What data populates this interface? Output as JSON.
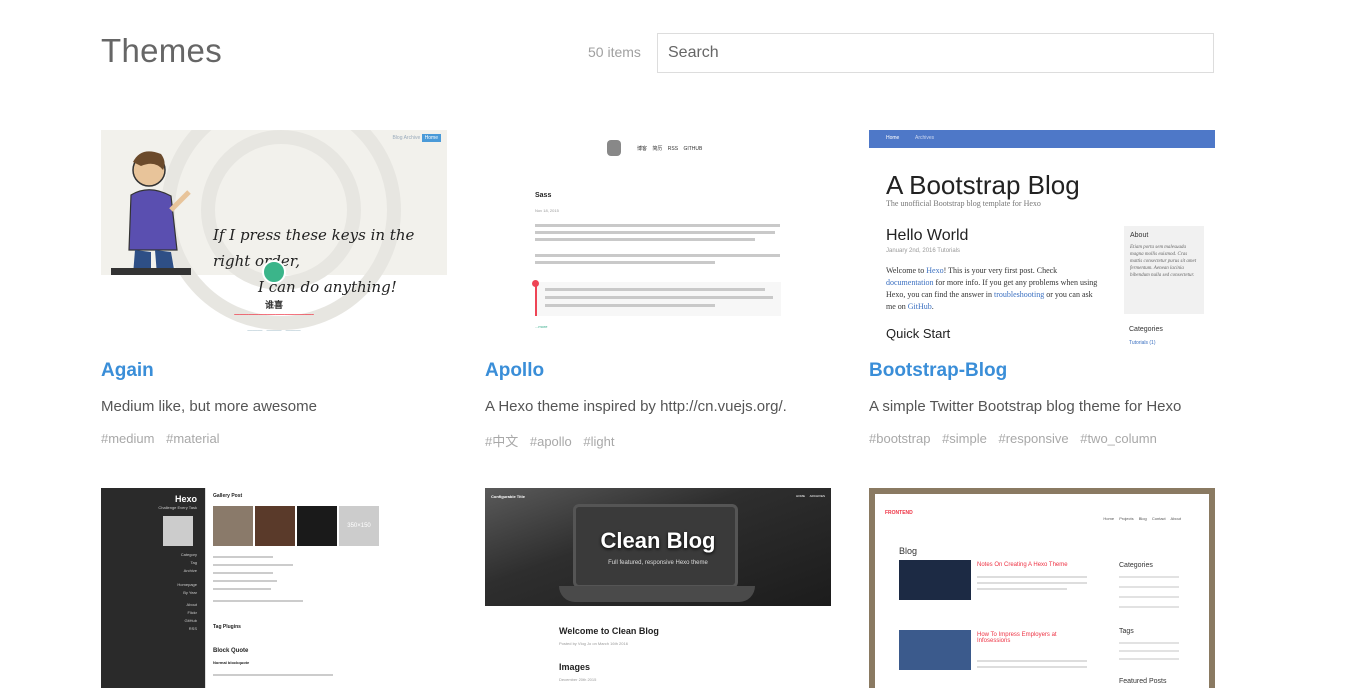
{
  "header": {
    "title": "Themes",
    "count": "50 items",
    "search_placeholder": "Search"
  },
  "themes": [
    {
      "name": "Again",
      "description": "Medium like, but more awesome",
      "tags": [
        "#medium",
        "#material"
      ],
      "preview": {
        "nav": "Blog Archive",
        "nav_active": "Home",
        "quote_line1": "If I press these keys in the right order,",
        "quote_line2": "I can do anything!",
        "author": "谁喜"
      }
    },
    {
      "name": "Apollo",
      "description": "A Hexo theme inspired by http://cn.vuejs.org/.",
      "tags": [
        "#中文",
        "#apollo",
        "#light"
      ],
      "preview": {
        "nav": "博客 简历 RSS GITHUB",
        "post_title": "Sass",
        "post_date": "Nov 18, 2015",
        "more": "...more"
      }
    },
    {
      "name": "Bootstrap-Blog",
      "description": "A simple Twitter Bootstrap blog theme for Hexo",
      "tags": [
        "#bootstrap",
        "#simple",
        "#responsive",
        "#two_column"
      ],
      "preview": {
        "nav_home": "Home",
        "nav_archives": "Archives",
        "blog_title": "A Bootstrap Blog",
        "blog_subtitle": "The unofficial Bootstrap blog template for Hexo",
        "post_title": "Hello World",
        "post_meta": "January 2nd, 2016   Tutorials",
        "post_body_1": "Welcome to ",
        "post_link_1": "Hexo",
        "post_body_2": "! This is your very first post. Check ",
        "post_link_2": "documentation",
        "post_body_3": " for more info. If you get any problems when using Hexo, you can find the answer in ",
        "post_link_3": "troubleshooting",
        "post_body_4": " or you can ask me on ",
        "post_link_4": "GitHub",
        "post_body_5": ".",
        "section": "Quick Start",
        "about_title": "About",
        "about_text": "Etiam porta sem malesuada magna mollis euismod. Cras mattis consectetur purus sit amet fermentum. Aenean lacinia bibendum nulla sed consectetur.",
        "categories_title": "Categories",
        "categories_item": "Tutorials (1)"
      }
    },
    {
      "name": "",
      "preview": {
        "site_title": "Hexo",
        "site_sub": "Challenge Every Task",
        "gallery_title": "Gallery Post",
        "tag_title": "Tag Plugins",
        "block_title": "Block Quote",
        "normal_title": "Normal blockquote",
        "menu": [
          "Category",
          "Tag",
          "Archive",
          "Homepage",
          "By Year",
          "About",
          "Flickr",
          "GitHub",
          "RSS"
        ],
        "placeholder": "350×150"
      }
    },
    {
      "name": "",
      "preview": {
        "configurable": "Configurable Title",
        "nav": "HOME ARCHIVES",
        "hero_title": "Clean Blog",
        "hero_sub": "Full featured, responsive Hexo theme",
        "post1_title": "Welcome to Clean Blog",
        "post1_meta": "Posted by Vlog Jo on March 16th 2016",
        "post2_title": "Images",
        "post2_meta": "December 20th 2015"
      }
    },
    {
      "name": "",
      "preview": {
        "brand": "FRONTEND",
        "nav": "Home Projects Blog Contact About",
        "heading": "Blog",
        "post1_title": "Notes On Creating A Hexo Theme",
        "post2_title": "How To Impress Employers at Infosessions",
        "side1": "Categories",
        "side2": "Tags",
        "side3": "Featured Posts"
      }
    }
  ]
}
